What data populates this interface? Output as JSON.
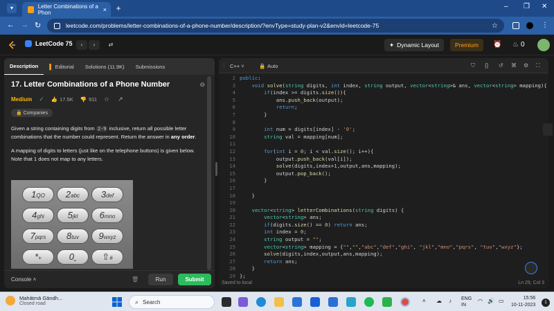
{
  "browser": {
    "tab_title": "Letter Combinations of a Phon",
    "tab_close": "×",
    "new_tab": "+",
    "url": "leetcode.com/problems/letter-combinations-of-a-phone-number/description/?envType=study-plan-v2&envId=leetcode-75",
    "window_min": "–",
    "window_restore": "❐",
    "window_close": "✕"
  },
  "lc_header": {
    "brand": "LeetCode 75",
    "prev": "‹",
    "next": "›",
    "shuffle": "⇄",
    "dynamic_layout": "Dynamic Layout",
    "premium": "Premium",
    "fire_count": "0"
  },
  "left_tabs": [
    {
      "label": "Description"
    },
    {
      "label": "Editorial"
    },
    {
      "label": "Solutions (11.9K)"
    },
    {
      "label": "Submissions"
    }
  ],
  "problem": {
    "title": "17. Letter Combinations of a Phone Number",
    "difficulty": "Medium",
    "likes": "17.5K",
    "dislikes": "911",
    "companies": "Companies",
    "desc1_a": "Given a string containing digits from ",
    "desc1_code": "2-9",
    "desc1_b": " inclusive, return all possible letter combinations that the number could represent. Return the answer in ",
    "desc1_bold": "any order",
    "desc1_c": ".",
    "desc2": "A mapping of digits to letters (just like on the telephone buttons) is given below. Note that 1 does not map to any letters."
  },
  "keypad": [
    {
      "digit": "1",
      "letters": "QO"
    },
    {
      "digit": "2",
      "letters": "abc"
    },
    {
      "digit": "3",
      "letters": "def"
    },
    {
      "digit": "4",
      "letters": "ghi"
    },
    {
      "digit": "5",
      "letters": "jkl"
    },
    {
      "digit": "6",
      "letters": "mno"
    },
    {
      "digit": "7",
      "letters": "pqrs"
    },
    {
      "digit": "8",
      "letters": "tuv"
    },
    {
      "digit": "9",
      "letters": "wxyz"
    },
    {
      "digit": "*",
      "letters": "+"
    },
    {
      "digit": "0",
      "letters": "⎵"
    },
    {
      "digit": "#",
      "letters": "⇧"
    }
  ],
  "left_footer": {
    "console": "Console ˄",
    "run": "Run",
    "submit": "Submit"
  },
  "editor": {
    "language": "C++ ˅",
    "autosave": "Auto",
    "status": "Saved to local",
    "cursor": "Ln 29, Col 3",
    "line_numbers": [
      "2",
      "3",
      "4",
      "5",
      "6",
      "7",
      "8",
      "9",
      "10",
      "11",
      "12",
      "13",
      "14",
      "15",
      "16",
      "17",
      "18",
      "19",
      "20",
      "21",
      "22",
      "23",
      "24",
      "25",
      "26",
      "27",
      "28",
      "29"
    ]
  },
  "taskbar": {
    "weather_title": "Mahātmā Gāndh...",
    "weather_sub": "Closed road",
    "search": "Search",
    "lang_top": "ENG",
    "lang_bot": "IN",
    "time": "15:56",
    "date": "10-11-2023",
    "notif": "1"
  },
  "colors": {
    "accent_green": "#2cbb5d",
    "medium_yellow": "#ffb800",
    "premium_orange": "#ffa116",
    "browser_blue": "#2b5fa6"
  }
}
